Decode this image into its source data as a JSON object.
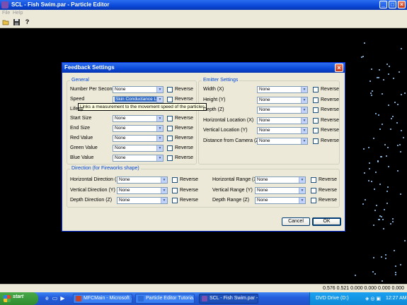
{
  "window": {
    "title": "SCL - Fish Swim.par - Particle Editor"
  },
  "menu": [
    "File",
    "Help"
  ],
  "toolbar": {
    "icons": [
      "open-icon",
      "save-icon",
      "help-icon"
    ]
  },
  "status": {
    "coords": "0.576 0.521 0.000 0.000 0.000 0.000"
  },
  "dialog": {
    "title": "Feedback Settings",
    "general": {
      "legend": "General",
      "rows": [
        {
          "label": "Number Per Second",
          "value": "None",
          "reverse": "Reverse"
        },
        {
          "label": "Speed",
          "value": "Skin Conductance Lev",
          "reverse": "Reverse",
          "selected": true
        },
        {
          "label": "Lifesp",
          "value": "",
          "reverse": "Reverse"
        },
        {
          "label": "Start Size",
          "value": "None",
          "reverse": "Reverse"
        },
        {
          "label": "End Size",
          "value": "None",
          "reverse": "Reverse"
        },
        {
          "label": "Red Value",
          "value": "None",
          "reverse": "Reverse"
        },
        {
          "label": "Green Value",
          "value": "None",
          "reverse": "Reverse"
        },
        {
          "label": "Blue Value",
          "value": "None",
          "reverse": "Reverse"
        }
      ],
      "tooltip": "Links a measurement to the movement speed of the particles"
    },
    "emitter": {
      "legend": "Emitter Settings",
      "rows": [
        {
          "label": "Width (X)",
          "value": "None",
          "reverse": "Reverse"
        },
        {
          "label": "Height (Y)",
          "value": "None",
          "reverse": "Reverse"
        },
        {
          "label": "Depth (Z)",
          "value": "None",
          "reverse": "Reverse"
        },
        {
          "label": "Horizontal Location (X)",
          "value": "None",
          "reverse": "Reverse"
        },
        {
          "label": "Vertical Location (Y)",
          "value": "None",
          "reverse": "Reverse"
        },
        {
          "label": "Distance from Camera (Z)",
          "value": "None",
          "reverse": "Reverse"
        }
      ]
    },
    "direction": {
      "legend": "Direction (for Fireworks shape)",
      "left": [
        {
          "label": "Horizontal Direction (X)",
          "value": "None",
          "reverse": "Reverse"
        },
        {
          "label": "Vertical Direction (Y)",
          "value": "None",
          "reverse": "Reverse"
        },
        {
          "label": "Depth Direction (Z)",
          "value": "None",
          "reverse": "Reverse"
        }
      ],
      "right": [
        {
          "label": "Horizontal Range (X)",
          "value": "None",
          "reverse": "Reverse"
        },
        {
          "label": "Vertical Range (Y)",
          "value": "None",
          "reverse": "Reverse"
        },
        {
          "label": "Depth Range (Z)",
          "value": "None",
          "reverse": "Reverse"
        }
      ]
    },
    "cancel": "Cancel",
    "ok": "OK"
  },
  "taskbar": {
    "start": "start",
    "tasks": [
      {
        "label": "MFCMain - Microsoft ...",
        "color": "#c8452b"
      },
      {
        "label": "Particle Editor Tutoria...",
        "color": "#2a6bd8"
      },
      {
        "label": "SCL - Fish Swim.par - ...",
        "color": "#7a4fb0",
        "active": true
      }
    ],
    "tray_text": "DVD Drive (D:)",
    "clock": "12:27 AM"
  }
}
